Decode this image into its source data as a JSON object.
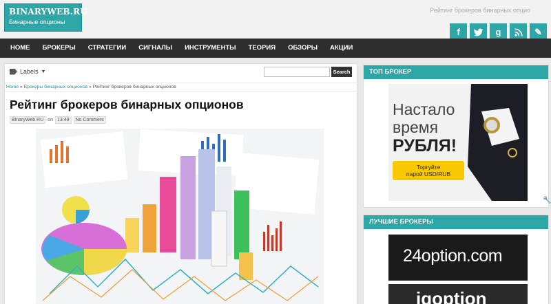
{
  "header": {
    "logo_title": "BINARYWEB.RU",
    "logo_subtitle": "Бинарные опционы",
    "tagline": "Рейтинг брокеров бинарных опцио"
  },
  "socials": [
    {
      "name": "facebook",
      "glyph": "f"
    },
    {
      "name": "twitter",
      "glyph": "t"
    },
    {
      "name": "google-plus",
      "glyph": "g"
    },
    {
      "name": "rss",
      "glyph": "◉"
    },
    {
      "name": "edit",
      "glyph": "✎"
    }
  ],
  "nav": [
    "HOME",
    "БРОКЕРЫ",
    "СТРАТЕГИИ",
    "СИГНАЛЫ",
    "ИНСТРУМЕНТЫ",
    "ТЕОРИЯ",
    "ОБЗОРЫ",
    "АКЦИИ"
  ],
  "labels_label": "Labels",
  "search": {
    "value": "",
    "button_label": "Search"
  },
  "breadcrumb": {
    "home": "Home",
    "sep": "»",
    "category": "Брокеры бинарных опционов",
    "current": "Рейтинг брокеров бинарных опционов"
  },
  "post": {
    "title": "Рейтинг брокеров бинарных опционов",
    "author": "BinaryWeb RU",
    "time_prefix": "on",
    "time": "13:49",
    "comments": "No Comment"
  },
  "sidebar": {
    "widget1_title": "ТОП БРОКЕР",
    "ad1": {
      "line1": "Настало",
      "line2": "время",
      "line3": "РУБЛЯ!",
      "button": "Торгуйте\nпарой USD/RUB"
    },
    "widget2_title": "ЛУЧШИЕ БРОКЕРЫ",
    "ad2": "24option.com",
    "ad3": "iqoption"
  },
  "colors": {
    "accent": "#2ca6a6",
    "nav_bg": "#2e2e2e",
    "gold": "#f7c800"
  }
}
